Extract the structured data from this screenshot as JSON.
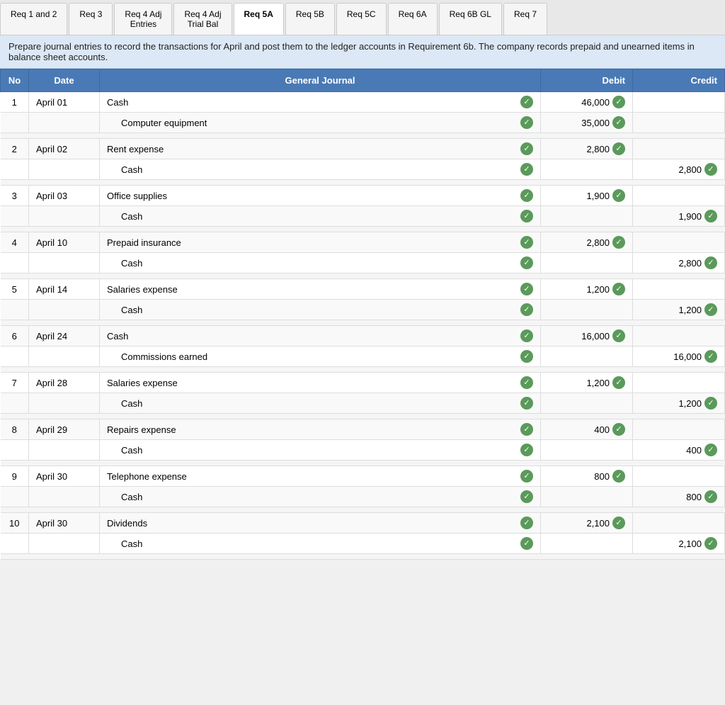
{
  "tabs": [
    {
      "id": "req-1-2",
      "label": "Req 1 and 2",
      "active": false
    },
    {
      "id": "req-3",
      "label": "Req 3",
      "active": false
    },
    {
      "id": "req-4-adj-entries",
      "label": "Req 4 Adj\nEntries",
      "active": false
    },
    {
      "id": "req-4-adj-trial-bal",
      "label": "Req 4 Adj\nTrial Bal",
      "active": false
    },
    {
      "id": "req-5a",
      "label": "Req 5A",
      "active": true
    },
    {
      "id": "req-5b",
      "label": "Req 5B",
      "active": false
    },
    {
      "id": "req-5c",
      "label": "Req 5C",
      "active": false
    },
    {
      "id": "req-6a",
      "label": "Req 6A",
      "active": false
    },
    {
      "id": "req-6b-gl",
      "label": "Req 6B GL",
      "active": false
    },
    {
      "id": "req-7",
      "label": "Req 7",
      "active": false
    }
  ],
  "instruction": "Prepare journal entries to record the transactions for April and post them to the ledger accounts in Requirement 6b. The company records prepaid and unearned items in balance sheet accounts.",
  "table": {
    "headers": [
      "No",
      "Date",
      "General Journal",
      "Debit",
      "Credit"
    ],
    "rows": [
      {
        "no": "1",
        "date": "April 01",
        "entries": [
          {
            "account": "Cash",
            "debit": "46,000",
            "credit": "",
            "indented": false
          },
          {
            "account": "Computer equipment",
            "debit": "35,000",
            "credit": "",
            "indented": true
          }
        ]
      },
      {
        "no": "2",
        "date": "April 02",
        "entries": [
          {
            "account": "Rent expense",
            "debit": "2,800",
            "credit": "",
            "indented": false
          },
          {
            "account": "Cash",
            "debit": "",
            "credit": "2,800",
            "indented": true
          }
        ]
      },
      {
        "no": "3",
        "date": "April 03",
        "entries": [
          {
            "account": "Office supplies",
            "debit": "1,900",
            "credit": "",
            "indented": false
          },
          {
            "account": "Cash",
            "debit": "",
            "credit": "1,900",
            "indented": true
          }
        ]
      },
      {
        "no": "4",
        "date": "April 10",
        "entries": [
          {
            "account": "Prepaid insurance",
            "debit": "2,800",
            "credit": "",
            "indented": false
          },
          {
            "account": "Cash",
            "debit": "",
            "credit": "2,800",
            "indented": true
          }
        ]
      },
      {
        "no": "5",
        "date": "April 14",
        "entries": [
          {
            "account": "Salaries expense",
            "debit": "1,200",
            "credit": "",
            "indented": false
          },
          {
            "account": "Cash",
            "debit": "",
            "credit": "1,200",
            "indented": true
          }
        ]
      },
      {
        "no": "6",
        "date": "April 24",
        "entries": [
          {
            "account": "Cash",
            "debit": "16,000",
            "credit": "",
            "indented": false
          },
          {
            "account": "Commissions earned",
            "debit": "",
            "credit": "16,000",
            "indented": true
          }
        ]
      },
      {
        "no": "7",
        "date": "April 28",
        "entries": [
          {
            "account": "Salaries expense",
            "debit": "1,200",
            "credit": "",
            "indented": false
          },
          {
            "account": "Cash",
            "debit": "",
            "credit": "1,200",
            "indented": true
          }
        ]
      },
      {
        "no": "8",
        "date": "April 29",
        "entries": [
          {
            "account": "Repairs expense",
            "debit": "400",
            "credit": "",
            "indented": false
          },
          {
            "account": "Cash",
            "debit": "",
            "credit": "400",
            "indented": true
          }
        ]
      },
      {
        "no": "9",
        "date": "April 30",
        "entries": [
          {
            "account": "Telephone expense",
            "debit": "800",
            "credit": "",
            "indented": false
          },
          {
            "account": "Cash",
            "debit": "",
            "credit": "800",
            "indented": true
          }
        ]
      },
      {
        "no": "10",
        "date": "April 30",
        "entries": [
          {
            "account": "Dividends",
            "debit": "2,100",
            "credit": "",
            "indented": false
          },
          {
            "account": "Cash",
            "debit": "",
            "credit": "2,100",
            "indented": true
          }
        ]
      }
    ]
  }
}
